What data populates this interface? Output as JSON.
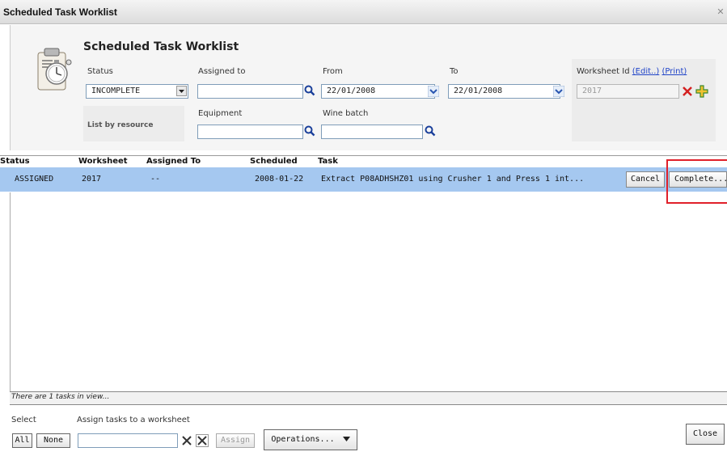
{
  "window": {
    "title": "Scheduled Task Worklist",
    "close_glyph": "✕"
  },
  "panel": {
    "title": "Scheduled Task Worklist",
    "icon": "clipboard-stopwatch-icon",
    "status_label": "Status",
    "status_value": "INCOMPLETE",
    "assigned_label": "Assigned to",
    "assigned_value": "",
    "from_label": "From",
    "from_value": "22/01/2008",
    "to_label": "To",
    "to_value": "22/01/2008",
    "worksheet_label": "Worksheet Id",
    "worksheet_edit": "(Edit..)",
    "worksheet_print": "(Print)",
    "worksheet_value": "2017",
    "list_by_label": "List by resource",
    "equipment_label": "Equipment",
    "equipment_value": "",
    "wine_batch_label": "Wine batch",
    "wine_batch_value": ""
  },
  "table": {
    "headers": [
      "Status",
      "Worksheet",
      "Assigned To",
      "Scheduled",
      "Task"
    ],
    "rows": [
      {
        "status": "ASSIGNED",
        "worksheet": "2017",
        "assigned_to": "--",
        "scheduled": "2008-01-22",
        "task": "Extract P08ADHSHZ01 using Crusher 1 and Press 1 int...",
        "cancel_label": "Cancel",
        "complete_label": "Complete..."
      }
    ]
  },
  "status_text": "There are 1 tasks in view...",
  "footer": {
    "select_label": "Select",
    "assign_label": "Assign tasks to a worksheet",
    "all_label": "All",
    "none_label": "None",
    "assign_input_value": "",
    "assign_button": "Assign",
    "operations_button": "Operations...",
    "close_button": "Close"
  },
  "colors": {
    "selected_row": "#a5c8f0",
    "highlight": "#e0202a",
    "link": "#2044c8"
  }
}
